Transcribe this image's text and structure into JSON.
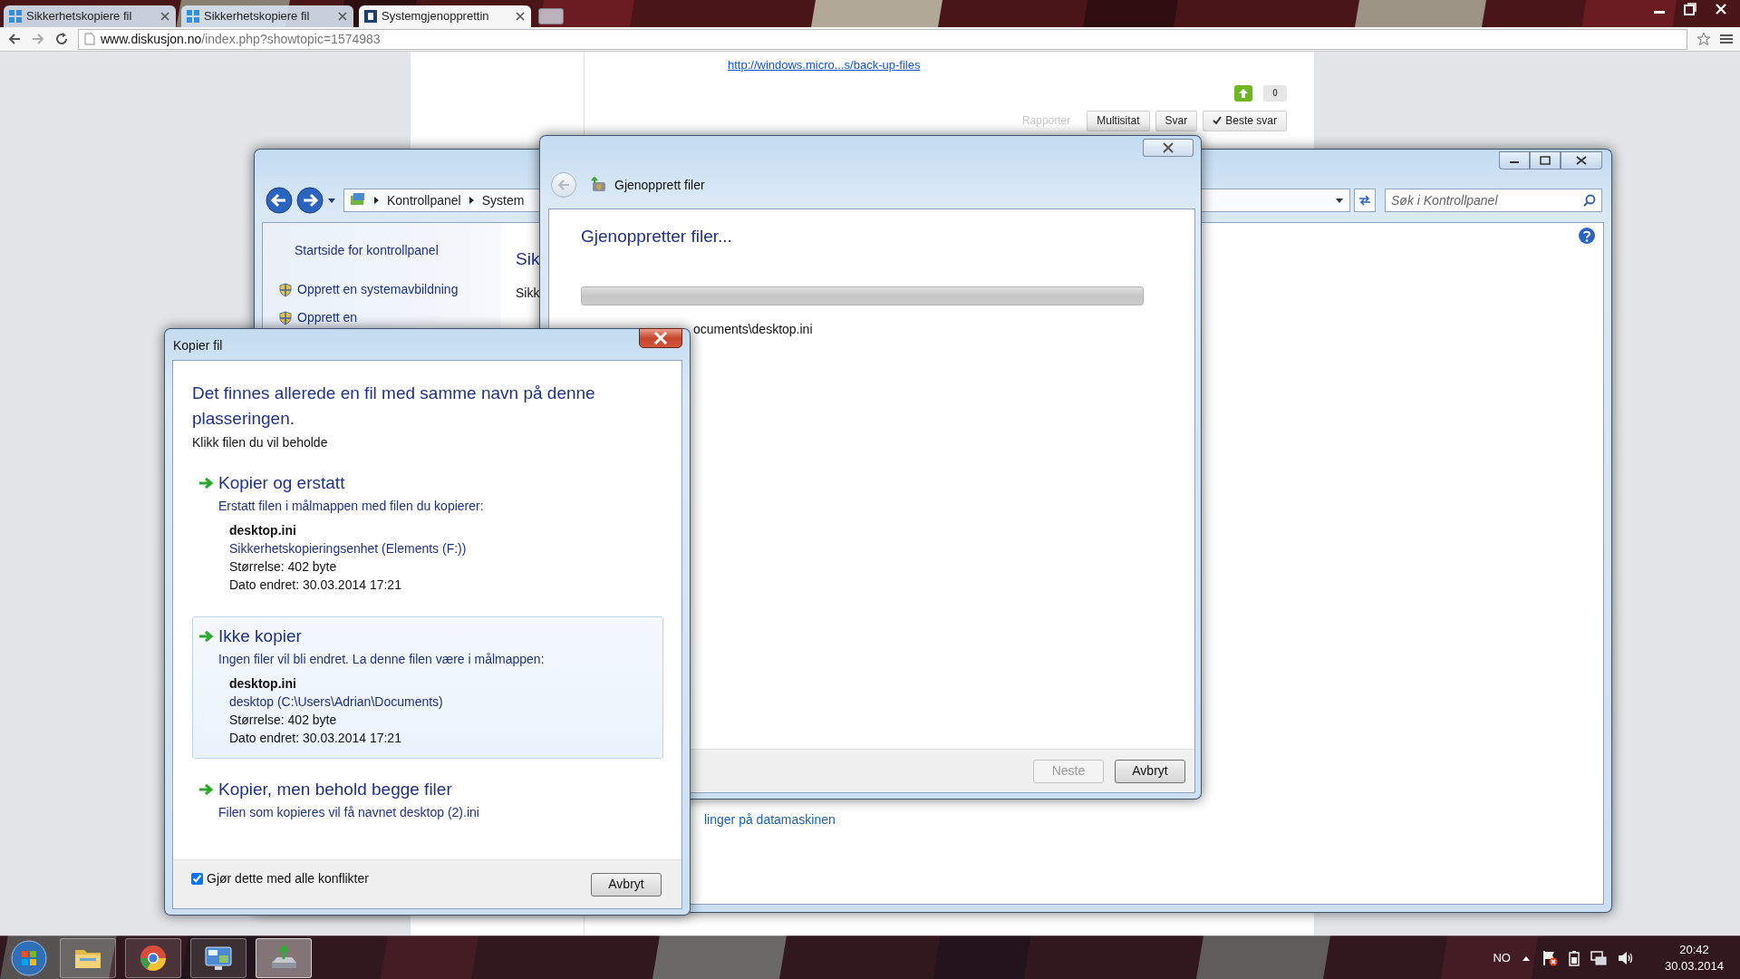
{
  "browser": {
    "tabs": [
      {
        "title": "Sikkerhetskopiere fil",
        "kind": "tiles",
        "selected": false
      },
      {
        "title": "Sikkerhetskopiere fil",
        "kind": "tiles",
        "selected": false
      },
      {
        "title": "Systemgjenopprettin",
        "kind": "page",
        "selected": true
      }
    ],
    "url_host": "www.diskusjon.no",
    "url_path": "/index.php?showtopic=1574983"
  },
  "forum_post": {
    "link": "http://windows.micro...s/back-up-files",
    "vote_count": "0",
    "report": "Rapporter",
    "actions": [
      {
        "label": "Multisitat",
        "kind": "plain"
      },
      {
        "label": "Svar",
        "kind": "plain"
      },
      {
        "label": "Beste svar",
        "kind": "check"
      }
    ]
  },
  "control_panel": {
    "breadcrumb": [
      "Kontrollpanel",
      "System"
    ],
    "search": {
      "placeholder": "Søk i Kontrollpanel"
    },
    "sidebar": {
      "home": "Startside for kontrollpanel",
      "items": [
        "Opprett en systemavbildning",
        "Opprett en"
      ]
    },
    "heading": "Sik",
    "text": "Sikk",
    "link": "linger på datamaskinen"
  },
  "restore_dialog": {
    "title": "Gjenopprett filer",
    "heading": "Gjenoppretter filer...",
    "progress": {
      "level": 0
    },
    "current_file": "ocuments\\desktop.ini",
    "buttons": [
      {
        "label": "Neste",
        "disabled": true
      },
      {
        "label": "Avbryt",
        "disabled": false
      }
    ]
  },
  "copy_dialog": {
    "title": "Kopier fil",
    "heading": "Det finnes allerede en fil med samme navn på denne plasseringen.",
    "instruction": "Klikk filen du vil beholde",
    "options": [
      {
        "title": "Kopier og erstatt",
        "description": "Erstatt filen i målmappen med filen du kopierer:",
        "selected": false,
        "file": {
          "name": "desktop.ini",
          "location": "Sikkerhetskopieringsenhet (Elements (F:))",
          "size": "Størrelse: 402 byte",
          "modified": "Dato endret: 30.03.2014 17:21"
        }
      },
      {
        "title": "Ikke kopier",
        "description": "Ingen filer vil bli endret. La denne filen være i målmappen:",
        "selected": true,
        "file": {
          "name": "desktop.ini",
          "location": "desktop (C:\\Users\\Adrian\\Documents)",
          "size": "Størrelse: 402 byte",
          "modified": "Dato endret: 30.03.2014 17:21"
        }
      },
      {
        "title": "Kopier, men behold begge filer",
        "description": "Filen som kopieres vil få navnet desktop (2).ini",
        "selected": false
      }
    ],
    "apply_all": {
      "label": "Gjør dette med alle konflikter",
      "checked": true
    },
    "cancel": "Avbryt"
  },
  "taskbar": {
    "apps": [
      {
        "kind": "folder",
        "selected": false
      },
      {
        "kind": "browser",
        "selected": false
      },
      {
        "kind": "control-panel",
        "selected": false
      },
      {
        "kind": "backup",
        "selected": true
      }
    ],
    "language": "NO",
    "time": "20:42",
    "date": "30.03.2014"
  }
}
